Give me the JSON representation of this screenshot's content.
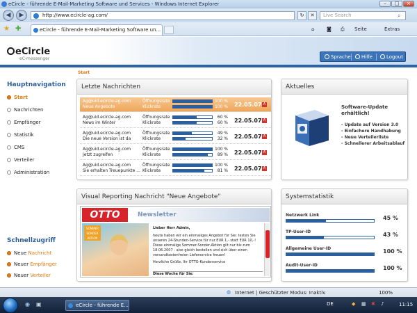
{
  "browser": {
    "window_title": "eCircle - führende E-Mail-Marketing Software und Services - Windows Internet Explorer",
    "address": "http://www.ecircle-ag.com/",
    "search_placeholder": "Live Search",
    "tab_title": "eCircle - führende E-Mail-Marketing Software un...",
    "tools": {
      "page": "Seite",
      "extras": "Extras"
    },
    "status_text": "Internet | Geschützter Modus: Inaktiv",
    "zoom": "100%"
  },
  "header": {
    "logo": "eCircle",
    "logo_sub": "eC-messenger",
    "buttons": {
      "help_lang": "Sprache",
      "help": "Hilfe",
      "logout": "Logout"
    }
  },
  "breadcrumb": "Start",
  "sidebar": {
    "main_heading": "Hauptnavigation",
    "items": [
      {
        "label": "Start"
      },
      {
        "label": "Nachrichten"
      },
      {
        "label": "Empfänger"
      },
      {
        "label": "Statistik"
      },
      {
        "label": "CMS"
      },
      {
        "label": "Verteiler"
      },
      {
        "label": "Administration"
      }
    ],
    "quick_heading": "Schnellzugriff",
    "quick": [
      {
        "prefix": "Neue",
        "label": "Nachricht"
      },
      {
        "prefix": "Neuer",
        "label": "Empfänger"
      },
      {
        "prefix": "Neuer",
        "label": "Verteiler"
      }
    ]
  },
  "news": {
    "title": "Letzte Nachrichten",
    "open_label": "Öffnungsrate",
    "click_label": "Klickrate",
    "messages": [
      {
        "from": "Ag@uid.ecircle-ag.com",
        "subject": "Neue Angebote",
        "open": 100,
        "open_text": "100 %",
        "click": 100,
        "click_text": "100 %",
        "date": "22.05.07"
      },
      {
        "from": "Ag@uid.ecircle-ag.com",
        "subject": "News im Winter",
        "open": 60,
        "open_text": "60 %",
        "click": 60,
        "click_text": "60 %",
        "date": "22.05.07"
      },
      {
        "from": "Ag@uid.ecircle-ag.com",
        "subject": "Die neue Version ist da",
        "open": 49,
        "open_text": "49 %",
        "click": 32,
        "click_text": "32 %",
        "date": "22.05.07"
      },
      {
        "from": "Ag@uid.ecircle-ag.com",
        "subject": "Jetzt zugreifen",
        "open": 100,
        "open_text": "100 %",
        "click": 89,
        "click_text": "89 %",
        "date": "22.05.07"
      },
      {
        "from": "Ag@uid.ecircle-ag.com",
        "subject": "Sie erhalten Treuepunkte ...",
        "open": 100,
        "open_text": "100 %",
        "click": 81,
        "click_text": "81 %",
        "date": "22.05.07"
      }
    ]
  },
  "aktuelles": {
    "title": "Aktuelles",
    "update_title": "Software-Update",
    "update_sub": "erhältlich!",
    "items": [
      "- Update auf Version 3.0",
      "- Einfachere Handhabung",
      "- Neue Verteilerliste",
      "- Schnellerer Arbeitsablauf"
    ]
  },
  "report": {
    "title": "Visual Reporting Nachricht \"Neue Angebote\"",
    "brand": "OTTO",
    "newsletter": "Newsletter",
    "badge": "SOMMER SONDER AKTION",
    "greeting": "Lieber Herr Admin,",
    "body": "heute haben wir ein einmaliges Angebot für Sie: testen Sie unseren 24-Stunden-Service für nur EUR 1,- statt EUR 10,-! Diese einmalige Sommer-Sonder-Aktion gilt nur bis zum 18.06.2007 - also gleich bestellen und sich über einen versandkostenfreien Lieferservice freuen!",
    "closing": "Herzliche Grüße, Ihr OTTO-Kundenservice",
    "week": "Diese Woche für Sie:"
  },
  "system": {
    "title": "Systemstatistik",
    "rows": [
      {
        "label": "Netzwerk Link",
        "value": 45,
        "text": "45 %"
      },
      {
        "label": "TP-User-ID",
        "value": 43,
        "text": "43 %"
      },
      {
        "label": "Allgemeine User-ID",
        "value": 100,
        "text": "100 %"
      },
      {
        "label": "Audit-User-ID",
        "value": 100,
        "text": "100 %"
      }
    ]
  },
  "taskbar": {
    "task": "eCircle - führende E...",
    "lang": "DE",
    "clock": "11:15"
  },
  "colors": {
    "accent": "#2d62a6",
    "orange": "#e07a10",
    "otto_red": "#d8232a"
  }
}
